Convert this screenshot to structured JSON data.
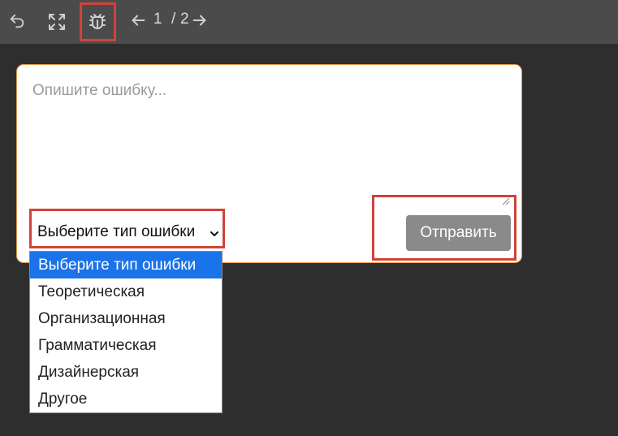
{
  "toolbar": {
    "icons": [
      "undo-icon",
      "fullscreen-icon",
      "bug-report-icon",
      "arrow-left-icon",
      "arrow-right-icon"
    ],
    "page_current": "1",
    "page_separator": "/",
    "page_total": "2"
  },
  "form": {
    "description_placeholder": "Опишите ошибку...",
    "description_value": "",
    "error_type_selected": "Выберите тип ошибки",
    "submit_label": "Отправить"
  },
  "dropdown": {
    "options": [
      "Выберите тип ошибки",
      "Теоретическая",
      "Организационная",
      "Грамматическая",
      "Дизайнерская",
      "Другое"
    ]
  },
  "colors": {
    "toolbar_bg": "#4b4b4b",
    "page_bg": "#2e2e2e",
    "card_border": "#e49a4e",
    "highlight": "#d0423a",
    "option_selected_bg": "#1a73e8",
    "submit_bg": "#8a8a8a"
  }
}
